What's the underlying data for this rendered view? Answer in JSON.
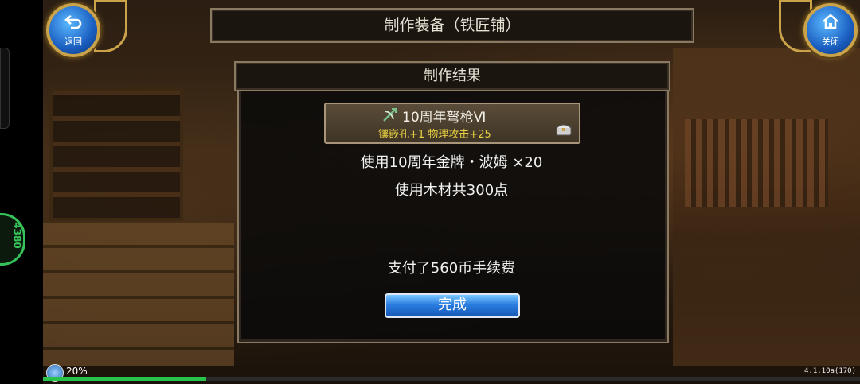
{
  "header": {
    "back_button": {
      "label": "返回",
      "icon": "back-arrow-icon"
    },
    "close_button": {
      "label": "关闭",
      "icon": "home-icon"
    },
    "window_title": "制作装备（铁匠铺）"
  },
  "dialog": {
    "title": "制作结果",
    "item": {
      "name": "10周年弩枪Ⅵ",
      "stats": "镶嵌孔+1 物理攻击+25",
      "icon": "crossbow-icon",
      "secondary_icon": "treasure-chest-icon",
      "stats_color": "#e8d040"
    },
    "materials_line1": "使用10周年金牌・波姆 ×20",
    "materials_line2": "使用木材共300点",
    "fee_text": "支付了560币手续费",
    "done_button": "完成"
  },
  "footer": {
    "progress_percent": 20,
    "progress_label": "20%",
    "version": "4.1.10a(170)"
  },
  "side_badge": {
    "text": "4380"
  },
  "colors": {
    "accent_blue": "#2a7ee0",
    "gold_trim": "#c9a24a",
    "progress_green": "#29c24a"
  }
}
